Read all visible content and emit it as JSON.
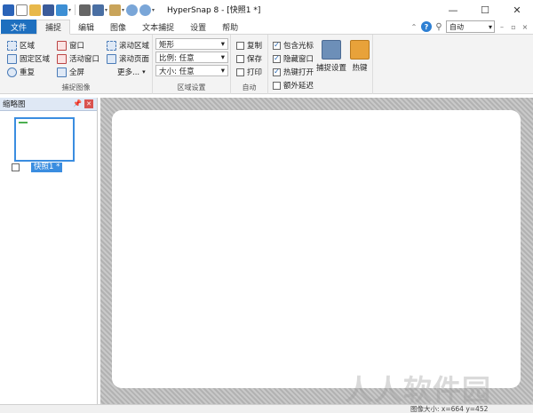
{
  "window": {
    "title": "HyperSnap 8 - [快照1 *]",
    "controls": [
      "—",
      "☐",
      "✕"
    ]
  },
  "tabs": [
    {
      "label": "文件"
    },
    {
      "label": "捕捉"
    },
    {
      "label": "编辑"
    },
    {
      "label": "图像"
    },
    {
      "label": "文本捕捉"
    },
    {
      "label": "设置"
    },
    {
      "label": "帮助"
    }
  ],
  "mode_select": {
    "value": "自动"
  },
  "ribbon": {
    "capture_image": {
      "label": "捕捉图像",
      "col1": [
        "区域",
        "固定区域",
        "重复"
      ],
      "col2": [
        "窗口",
        "活动窗口",
        "全屏"
      ],
      "col3": [
        "滚动区域",
        "滚动页面",
        "更多..."
      ]
    },
    "region_settings": {
      "label": "区域设置",
      "shape": "矩形",
      "ratio": "比例: 任意",
      "size": "大小: 任意"
    },
    "auto": {
      "label": "自动",
      "items": [
        {
          "label": "复制",
          "checked": false
        },
        {
          "label": "保存",
          "checked": false
        },
        {
          "label": "打印",
          "checked": false
        }
      ]
    },
    "options": {
      "items": [
        {
          "label": "包含光标",
          "checked": true
        },
        {
          "label": "隐藏窗口",
          "checked": true
        },
        {
          "label": "热键打开",
          "checked": true
        },
        {
          "label": "额外延迟",
          "checked": false
        }
      ]
    },
    "big_buttons": [
      "捕捉设置",
      "热键"
    ]
  },
  "thumbnail_panel": {
    "title": "缩略图",
    "item_label": "快照1 *"
  },
  "status": {
    "text": "图像大小: x=664  y=452"
  },
  "watermark": "人人软件园",
  "colors": {
    "accent": "#1e6fbf",
    "selection": "#3a8de0"
  }
}
